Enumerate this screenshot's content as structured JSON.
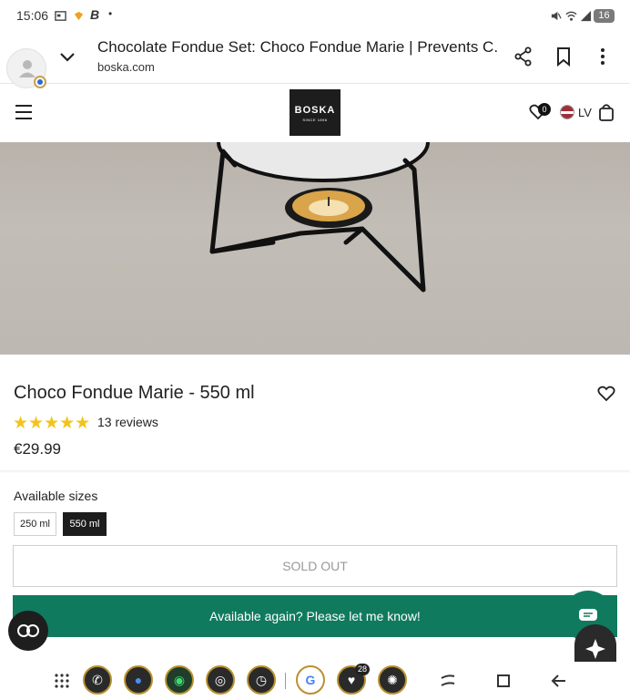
{
  "status_bar": {
    "time": "15:06",
    "battery": "16"
  },
  "browser": {
    "title": "Chocolate Fondue Set: Choco Fondue Marie | Prevents C...",
    "domain": "boska.com"
  },
  "site_header": {
    "logo_text": "BOSKA",
    "logo_sub": "SINCE 1896",
    "wishlist_count": "0",
    "language": "LV"
  },
  "product": {
    "title": "Choco Fondue Marie - 550 ml",
    "rating": 5,
    "rating_stars": "★★★★★",
    "reviews": "13 reviews",
    "price": "€29.99",
    "sizes_label": "Available sizes",
    "sizes": [
      "250 ml",
      "550 ml"
    ],
    "selected_size": "550 ml",
    "sold_out_label": "SOLD OUT",
    "notify_label": "Available again? Please let me know!"
  },
  "nav_bar": {
    "badge_count": "28"
  },
  "colors": {
    "accent_green": "#107a5e",
    "star_yellow": "#f2c41b",
    "dark": "#1d1d1d"
  }
}
